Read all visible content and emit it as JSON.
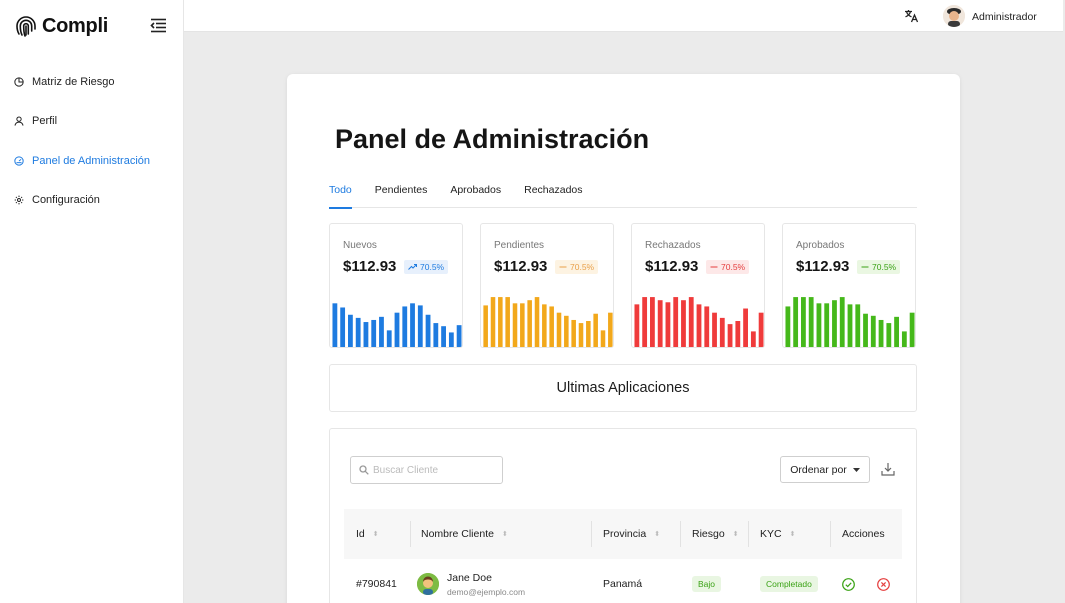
{
  "app": {
    "brand": "Compli"
  },
  "sidebar": {
    "items": [
      {
        "label": "Matriz de Riesgo",
        "icon": "pie-chart-icon",
        "active": false
      },
      {
        "label": "Perfil",
        "icon": "user-icon",
        "active": false
      },
      {
        "label": "Panel de Administración",
        "icon": "dashboard-gauge-icon",
        "active": true
      },
      {
        "label": "Configuración",
        "icon": "gear-icon",
        "active": false
      }
    ]
  },
  "header": {
    "user_name": "Administrador",
    "translate_icon": "translate-icon"
  },
  "main": {
    "title": "Panel de Administración",
    "tabs": [
      {
        "label": "Todo",
        "active": true
      },
      {
        "label": "Pendientes",
        "active": false
      },
      {
        "label": "Aprobados",
        "active": false
      },
      {
        "label": "Rechazados",
        "active": false
      }
    ],
    "stats": [
      {
        "label": "Nuevos",
        "value": "$112.93",
        "change": "70.5%",
        "trend": "up",
        "color": "#1e7be0",
        "badge_bg": "#e7f0fc",
        "badge_color": "#1e7be0",
        "bars": [
          0.84,
          0.76,
          0.62,
          0.56,
          0.48,
          0.52,
          0.58,
          0.32,
          0.66,
          0.78,
          0.84,
          0.8,
          0.62,
          0.46,
          0.4,
          0.28,
          0.42
        ]
      },
      {
        "label": "Pendientes",
        "value": "$112.93",
        "change": "70.5%",
        "trend": "flat",
        "color": "#f2a81b",
        "badge_bg": "#fdf3e2",
        "badge_color": "#e9a04a",
        "bars": [
          0.8,
          0.96,
          0.96,
          0.96,
          0.84,
          0.84,
          0.9,
          0.96,
          0.82,
          0.78,
          0.66,
          0.6,
          0.52,
          0.46,
          0.5,
          0.64,
          0.32,
          0.66
        ]
      },
      {
        "label": "Rechazados",
        "value": "$112.93",
        "change": "70.5%",
        "trend": "flat",
        "color": "#ef3b3b",
        "badge_bg": "#fde8e8",
        "badge_color": "#e53e3e",
        "bars": [
          0.82,
          0.96,
          0.96,
          0.9,
          0.86,
          0.96,
          0.9,
          0.96,
          0.82,
          0.78,
          0.66,
          0.56,
          0.44,
          0.5,
          0.74,
          0.3,
          0.66
        ]
      },
      {
        "label": "Aprobados",
        "value": "$112.93",
        "change": "70.5%",
        "trend": "flat",
        "color": "#45b81a",
        "badge_bg": "#eaf7e2",
        "badge_color": "#3aa215",
        "bars": [
          0.78,
          0.96,
          0.96,
          0.96,
          0.84,
          0.84,
          0.9,
          0.96,
          0.82,
          0.82,
          0.64,
          0.6,
          0.52,
          0.46,
          0.58,
          0.3,
          0.66
        ]
      }
    ],
    "section_title": "Ultimas Aplicaciones",
    "search": {
      "placeholder": "Buscar Cliente",
      "value": ""
    },
    "sort_label": "Ordenar por",
    "table": {
      "columns": [
        "Id",
        "Nombre Cliente",
        "Provincia",
        "Riesgo",
        "KYC",
        "Acciones"
      ],
      "rows": [
        {
          "id": "#790841",
          "name": "Jane Doe",
          "email": "demo@ejemplo.com",
          "province": "Panamá",
          "risk": "Bajo",
          "kyc": "Completado"
        }
      ]
    }
  }
}
